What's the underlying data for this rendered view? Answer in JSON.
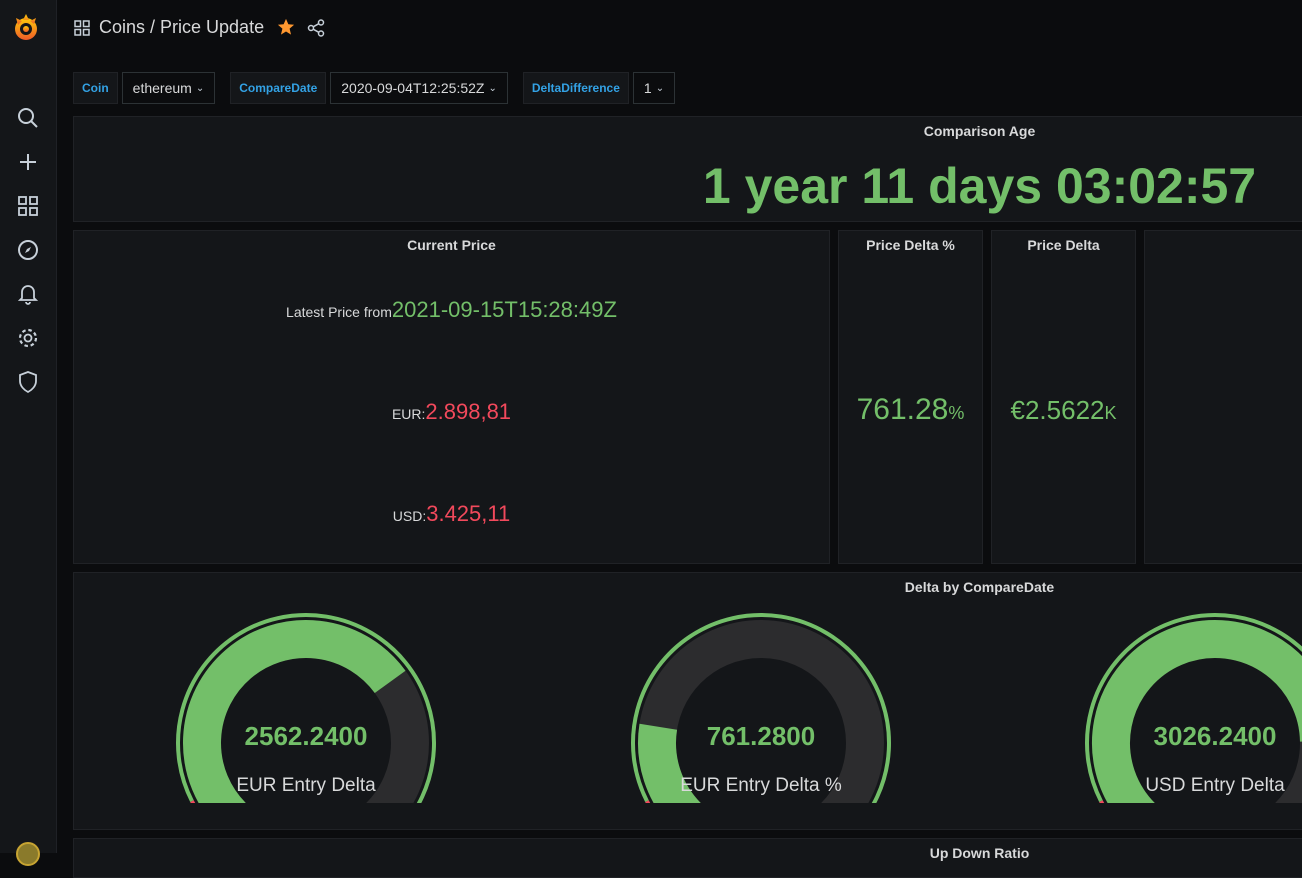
{
  "breadcrumb": "Coins / Price Update",
  "variables": [
    {
      "label": "Coin",
      "value": "ethereum"
    },
    {
      "label": "CompareDate",
      "value": "2020-09-04T12:25:52Z"
    },
    {
      "label": "DeltaDifference",
      "value": "1"
    }
  ],
  "panels": {
    "comparison_age": {
      "title": "Comparison Age",
      "value": "1 year 11 days 03:02:57"
    },
    "current_price": {
      "title": "Current Price",
      "latest_label": "Latest Price from",
      "latest_value": "2021-09-15T15:28:49Z",
      "eur_label": "EUR:",
      "eur_value": "2.898,81",
      "usd_label": "USD:",
      "usd_value": "3.425,11"
    },
    "price_delta_pct": {
      "title": "Price Delta %",
      "value": "761.28",
      "unit": "%"
    },
    "price_delta": {
      "title": "Price Delta",
      "value": "€2.5622",
      "unit": "K"
    },
    "delta_by_comparedate": {
      "title": "Delta by CompareDate",
      "gauges": [
        {
          "label": "EUR Entry Delta",
          "value": "2562.2400",
          "fill": 0.7
        },
        {
          "label": "EUR Entry Delta %",
          "value": "761.2800",
          "fill": 0.2
        },
        {
          "label": "USD Entry Delta",
          "value": "3026.2400",
          "fill": 0.83
        }
      ]
    },
    "up_down_ratio": {
      "title": "Up Down Ratio"
    }
  },
  "colors": {
    "green": "#73bf69",
    "red": "#f2495c",
    "accent": "#33a2e5",
    "star": "#ff9830"
  },
  "icons": [
    "grafana-logo",
    "search-icon",
    "plus-icon",
    "dashboards-icon",
    "explore-icon",
    "alert-bell-icon",
    "gear-icon",
    "shield-icon",
    "grid-icon",
    "star-icon",
    "share-icon"
  ]
}
